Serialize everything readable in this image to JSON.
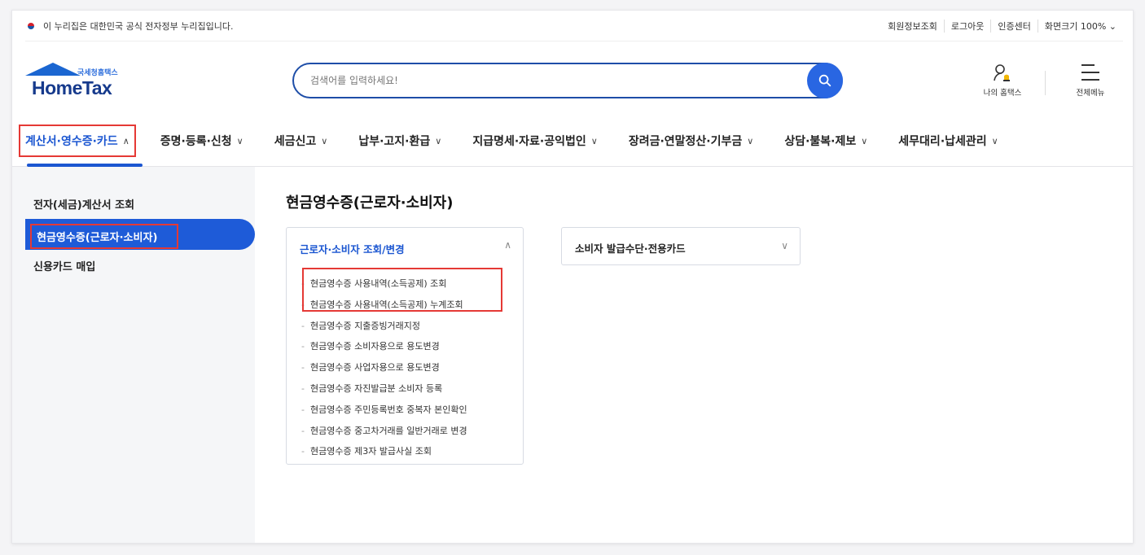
{
  "topbar": {
    "gov_notice": "이 누리집은 대한민국 공식 전자정부 누리집입니다.",
    "links": [
      "회원정보조회",
      "로그아웃",
      "인증센터"
    ],
    "zoom_label": "화면크기 100% ⌄"
  },
  "header": {
    "logo_sub": "국세청홈택스",
    "logo_text": "HomeTax",
    "search_placeholder": "검색어를 입력하세요!",
    "my_hometax": "나의 홈택스",
    "all_menu": "전체메뉴"
  },
  "nav": {
    "items": [
      {
        "label": "계산서·영수증·카드",
        "chev": "∧"
      },
      {
        "label": "증명·등록·신청",
        "chev": "∨"
      },
      {
        "label": "세금신고",
        "chev": "∨"
      },
      {
        "label": "납부·고지·환급",
        "chev": "∨"
      },
      {
        "label": "지급명세·자료·공익법인",
        "chev": "∨"
      },
      {
        "label": "장려금·연말정산·기부금",
        "chev": "∨"
      },
      {
        "label": "상담·불복·제보",
        "chev": "∨"
      },
      {
        "label": "세무대리·납세관리",
        "chev": "∨"
      }
    ]
  },
  "sidebar": {
    "items": [
      {
        "label": "전자(세금)계산서 조회"
      },
      {
        "label": "현금영수증(근로자·소비자)"
      },
      {
        "label": "신용카드 매입"
      }
    ]
  },
  "main": {
    "title": "현금영수증(근로자·소비자)",
    "card1": {
      "title": "근로자·소비자 조회/변경",
      "chev": "∧",
      "items": [
        "현금영수증 사용내역(소득공제) 조회",
        "현금영수증 사용내역(소득공제) 누계조회",
        "현금영수증 지출증빙거래지정",
        "현금영수증 소비자용으로 용도변경",
        "현금영수증 사업자용으로 용도변경",
        "현금영수증 자진발급분 소비자 등록",
        "현금영수증 주민등록번호 중복자 본인확인",
        "현금영수증 중고차거래를 일반거래로 변경",
        "현금영수증 제3자 발급사실 조회"
      ]
    },
    "card2": {
      "title": "소비자 발급수단·전용카드",
      "chev": "∨"
    }
  },
  "colors": {
    "accent": "#1b56d1",
    "highlight_box": "#e53935",
    "logo_dark": "#163a8c"
  }
}
